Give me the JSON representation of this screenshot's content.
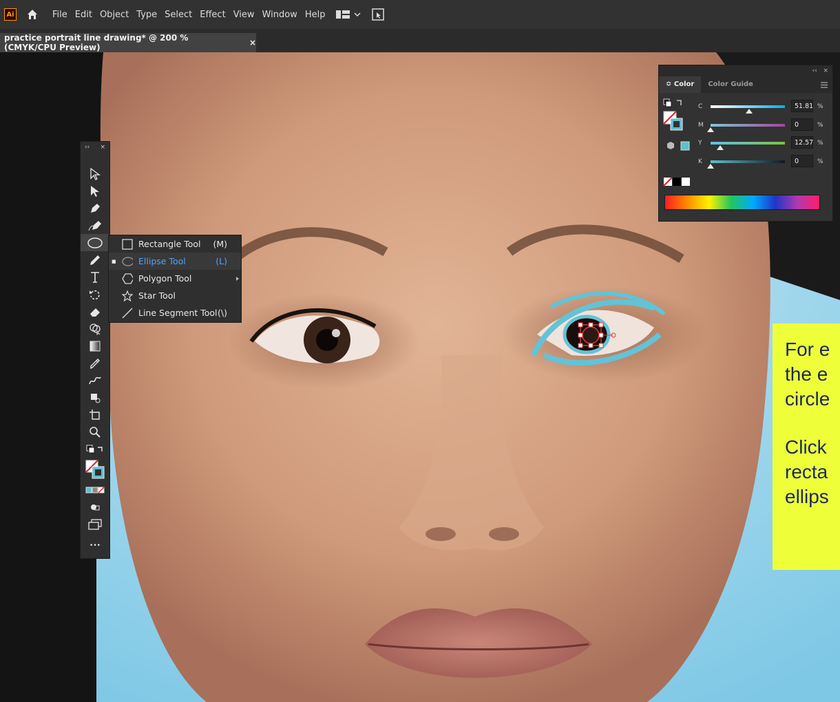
{
  "app": {
    "logo": "Ai",
    "menus": [
      "File",
      "Edit",
      "Object",
      "Type",
      "Select",
      "Effect",
      "View",
      "Window",
      "Help"
    ],
    "document_tab": "practice portrait line drawing* @ 200 % (CMYK/CPU Preview)",
    "tab_close": "×"
  },
  "toolbar": {
    "collapse": "››",
    "close": "×",
    "more": "•••"
  },
  "flyout": {
    "items": [
      {
        "label": "Rectangle Tool",
        "shortcut": "(M)",
        "icon": "rectangle-icon"
      },
      {
        "label": "Ellipse Tool",
        "shortcut": "(L)",
        "icon": "ellipse-icon",
        "selected": true
      },
      {
        "label": "Polygon Tool",
        "shortcut": "",
        "icon": "polygon-icon"
      },
      {
        "label": "Star Tool",
        "shortcut": "",
        "icon": "star-icon"
      },
      {
        "label": "Line Segment Tool",
        "shortcut": "(\\)",
        "icon": "line-icon"
      }
    ]
  },
  "color_panel": {
    "header_collapse": "‹‹",
    "header_close": "×",
    "tabs": [
      "Color",
      "Color Guide"
    ],
    "tab_prefix": "≎",
    "sliders": [
      {
        "label": "C",
        "value": "51.81",
        "unit": "%",
        "fraction": 0.52
      },
      {
        "label": "M",
        "value": "0",
        "unit": "%",
        "fraction": 0.0
      },
      {
        "label": "Y",
        "value": "12.57",
        "unit": "%",
        "fraction": 0.13
      },
      {
        "label": "K",
        "value": "0",
        "unit": "%",
        "fraction": 0.0
      }
    ],
    "fill_color": "#5cc0d0"
  },
  "note": {
    "lines1": [
      "For e",
      "the e",
      "circle"
    ],
    "lines2": [
      "Click",
      "recta",
      "ellips"
    ]
  },
  "colors": {
    "accent": "#4fa3ff",
    "stroke_cyan": "#63c3d6",
    "note_bg": "#eeff3a"
  }
}
